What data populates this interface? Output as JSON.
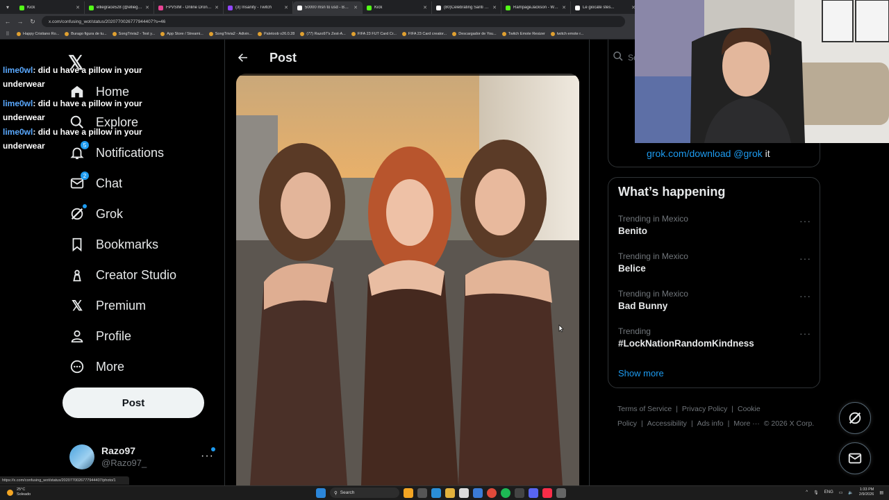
{
  "browser": {
    "tabs": [
      {
        "label": "Kick",
        "color": "#53fc18"
      },
      {
        "label": "elliegrace528 (@elliegrace...",
        "color": "#53fc18"
      },
      {
        "label": "FPVSIM - Online Drone S...",
        "color": "#e84393"
      },
      {
        "label": "(3) Insanity - Twitch",
        "color": "#9146ff"
      },
      {
        "label": "50000 msn to usd - Busc...",
        "color": "#ffffff"
      },
      {
        "label": "Kick",
        "color": "#53fc18"
      },
      {
        "label": "(80)Celebrating Santi Ca...",
        "color": "#ffffff"
      },
      {
        "label": "RampageJackson - Watc...",
        "color": "#53fc18"
      },
      {
        "label": "Le giocate stes...",
        "color": "#ffffff"
      }
    ],
    "url": "x.com/confusing_wot/status/2020770026777944407?s=46",
    "bookmarks": [
      "Happy Cristiano Ro...",
      "Burago figura de tu...",
      "SongTrivia2 - Test y...",
      "App Store / Streami...",
      "SongTrivia2 - Adivin...",
      "Paletoob v26.0.28",
      "(77) Razo97's Zest-A...",
      "FIFA 23 FUT Card Cr...",
      "FIFA 23 Card creator...",
      "Descargador de You...",
      "Twitch Emote Resizer",
      "twitch emote r..."
    ],
    "status_url": "https://x.com/confusing_wot/status/2020770026777944407/photo/1"
  },
  "chat": [
    {
      "user": "lime0wl",
      "text": ": did u have a pillow in your underwear"
    },
    {
      "user": "lime0wl",
      "text": ": did u have a pillow in your underwear"
    },
    {
      "user": "lime0wl",
      "text": ": did u have a pillow in your underwear"
    }
  ],
  "sidebar": {
    "items": [
      {
        "label": "Home",
        "icon": "home-icon"
      },
      {
        "label": "Explore",
        "icon": "search-icon",
        "badge": ""
      },
      {
        "label": "Notifications",
        "icon": "bell-icon",
        "badge": "5"
      },
      {
        "label": "Chat",
        "icon": "mail-icon",
        "badge": "2"
      },
      {
        "label": "Grok",
        "icon": "grok-icon"
      },
      {
        "label": "Bookmarks",
        "icon": "bookmark-icon"
      },
      {
        "label": "Creator Studio",
        "icon": "creator-studio-icon"
      },
      {
        "label": "Premium",
        "icon": "x-icon"
      },
      {
        "label": "Profile",
        "icon": "person-icon"
      },
      {
        "label": "More",
        "icon": "more-circle-icon"
      }
    ],
    "post_label": "Post",
    "account": {
      "name": "Razo97",
      "handle": "@Razo97_",
      "more": "···"
    }
  },
  "main": {
    "title": "Post"
  },
  "right": {
    "search_placeholder": "Se",
    "grok": {
      "link": "grok.com/download @grok",
      "suffix": " it"
    },
    "happening_title": "What’s happening",
    "trends": [
      {
        "context": "Trending in Mexico",
        "name": "Benito"
      },
      {
        "context": "Trending in Mexico",
        "name": "Belice"
      },
      {
        "context": "Trending in Mexico",
        "name": "Bad Bunny"
      },
      {
        "context": "Trending",
        "name": "#LockNationRandomKindness"
      }
    ],
    "show_more": "Show more",
    "footer": [
      "Terms of Service",
      "|",
      "Privacy Policy",
      "|",
      "Cookie Policy",
      "|",
      "Accessibility",
      "|",
      "Ads info",
      "|",
      "More ···",
      "© 2026 X Corp."
    ]
  },
  "taskbar": {
    "weather_temp": "25°C",
    "weather_desc": "Soleado",
    "search": "Search",
    "lang": "ENG",
    "time": "1:33 PM",
    "date": "2/9/2026"
  }
}
